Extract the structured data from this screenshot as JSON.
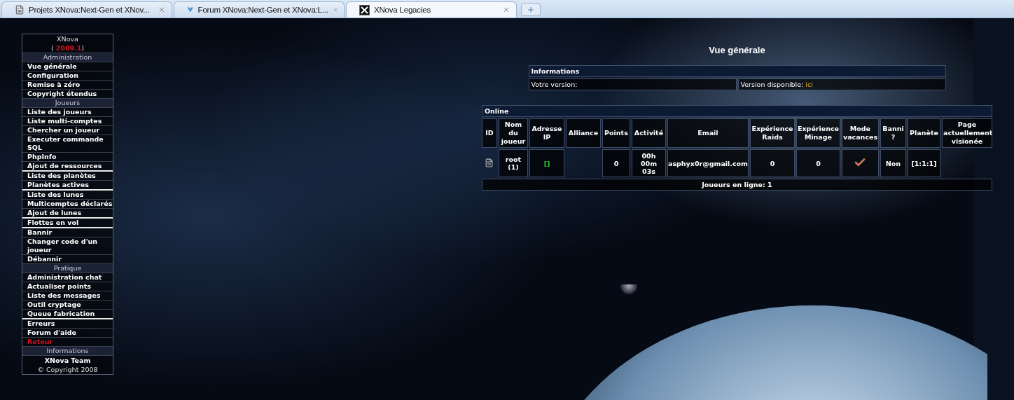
{
  "browser_tabs": [
    {
      "kind": "page",
      "title": "Projets XNova:Next-Gen et XNov...",
      "selected": false
    },
    {
      "kind": "forum",
      "title": "Forum XNova:Next-Gen et XNova:L...",
      "selected": false
    },
    {
      "kind": "xnova",
      "title": "XNova Legacies",
      "selected": true
    }
  ],
  "menu": {
    "brand": "XNova",
    "version_open": "(",
    "version": "2009.1",
    "version_close": ")",
    "entries": [
      {
        "kind": "section",
        "label": "Administration"
      },
      {
        "kind": "link",
        "label": "Vue générale",
        "divider_above": false
      },
      {
        "kind": "link",
        "label": "Configuration",
        "divider_above": false
      },
      {
        "kind": "link",
        "label": "Remise à zéro",
        "divider_above": false
      },
      {
        "kind": "link",
        "label": "Copyright étendus",
        "divider_above": false
      },
      {
        "kind": "section",
        "label": "Joueurs"
      },
      {
        "kind": "link",
        "label": "Liste des joueurs",
        "divider_above": false
      },
      {
        "kind": "link",
        "label": "Liste multi-comptes",
        "divider_above": false
      },
      {
        "kind": "link",
        "label": "Chercher un joueur",
        "divider_above": false
      },
      {
        "kind": "link",
        "label": "Executer commande SQL",
        "divider_above": false
      },
      {
        "kind": "link",
        "label": "PhpInfo",
        "divider_above": false
      },
      {
        "kind": "link",
        "label": "Ajout de ressources",
        "divider_above": false
      },
      {
        "kind": "link",
        "label": "Liste des planètes",
        "divider_above": true
      },
      {
        "kind": "link",
        "label": "Planètes actives",
        "divider_above": false
      },
      {
        "kind": "link",
        "label": "Liste des lunes",
        "divider_above": true
      },
      {
        "kind": "link",
        "label": "Multicomptes déclarés",
        "divider_above": false
      },
      {
        "kind": "link",
        "label": "Ajout de lunes",
        "divider_above": false
      },
      {
        "kind": "link",
        "label": "Flottes en vol",
        "divider_above": true
      },
      {
        "kind": "link",
        "label": "Bannir",
        "divider_above": true
      },
      {
        "kind": "link",
        "label": "Changer code d'un joueur",
        "divider_above": false
      },
      {
        "kind": "link",
        "label": "Débannir",
        "divider_above": false
      },
      {
        "kind": "section",
        "label": "Pratique"
      },
      {
        "kind": "link",
        "label": "Administration chat",
        "divider_above": false
      },
      {
        "kind": "link",
        "label": "Actualiser points",
        "divider_above": false
      },
      {
        "kind": "link",
        "label": "Liste des messages",
        "divider_above": false
      },
      {
        "kind": "link",
        "label": "Outil cryptage",
        "divider_above": false
      },
      {
        "kind": "link",
        "label": "Queue fabrication",
        "divider_above": false
      },
      {
        "kind": "link",
        "label": "Erreurs",
        "divider_above": true
      },
      {
        "kind": "link",
        "label": "Forum d'aide",
        "divider_above": false
      },
      {
        "kind": "return",
        "label": "Retour",
        "divider_above": false
      },
      {
        "kind": "section",
        "label": "Informations"
      }
    ],
    "team": "XNova Team",
    "copyright": "© Copyright 2008"
  },
  "page_title": "Vue générale",
  "informations": {
    "title": "Informations",
    "your_version": "Votre version:",
    "available_label": "Version disponible:",
    "available_link": "ici"
  },
  "online": {
    "title": "Online",
    "columns": [
      "ID",
      "Nom du joueur",
      "Adresse IP",
      "Alliance",
      "Points",
      "Activité",
      "Email",
      "Expérience Raids",
      "Expérience Minage",
      "Mode vacances",
      "Banni ?",
      "Planète",
      "Page actuellement visionée"
    ],
    "rows": [
      {
        "name": "root (1)",
        "ip": "[]",
        "points": "0",
        "activity": "00h 00m 03s",
        "email": "asphyx0r@gmail.com",
        "raids": "0",
        "minage": "0",
        "vacation": true,
        "banned": "Non",
        "planet": "[1:1:1]"
      }
    ],
    "footer": "Joueurs en ligne: 1"
  }
}
